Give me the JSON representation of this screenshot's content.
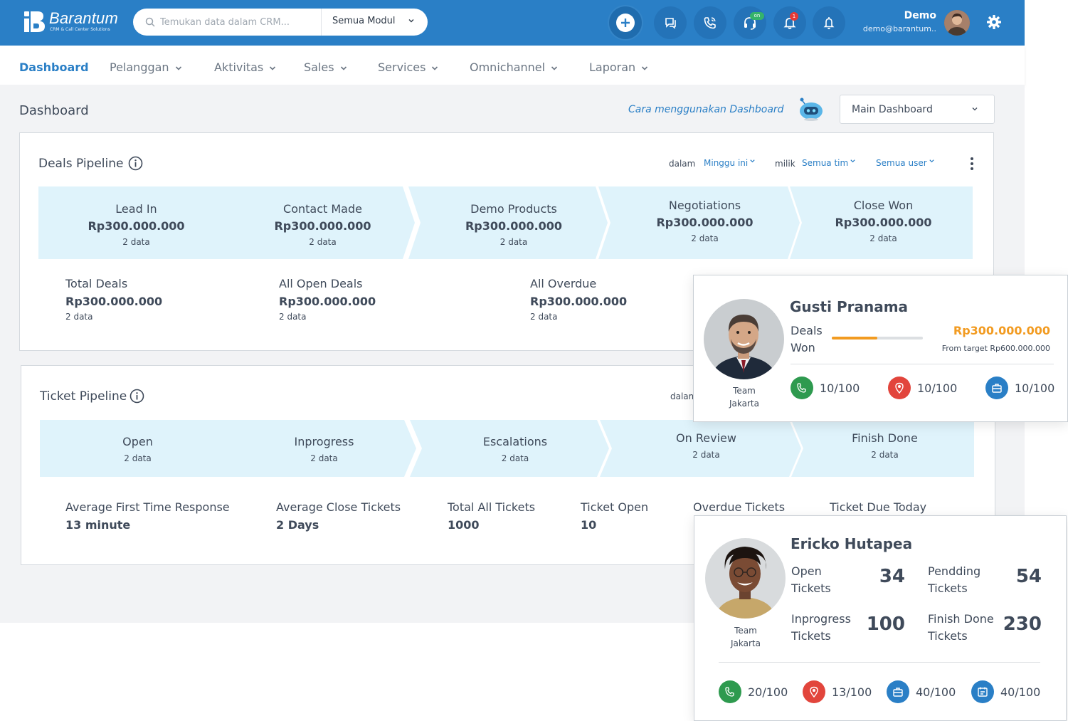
{
  "brand": {
    "name": "Barantum",
    "tagline": "CRM & Call Center Solutions"
  },
  "search": {
    "placeholder": "Temukan data dalam CRM...",
    "module": "Semua Modul"
  },
  "topbar": {
    "status_badge": "on",
    "notification_count": "1",
    "user_name": "Demo",
    "user_email": "demo@barantum.."
  },
  "nav": {
    "items": [
      {
        "label": "Dashboard",
        "active": true
      },
      {
        "label": "Pelanggan"
      },
      {
        "label": "Aktivitas"
      },
      {
        "label": "Sales"
      },
      {
        "label": "Services"
      },
      {
        "label": "Omnichannel"
      },
      {
        "label": "Laporan"
      }
    ]
  },
  "page": {
    "title": "Dashboard",
    "help_link": "Cara menggunakan Dashboard",
    "dashboard_select": "Main Dashboard"
  },
  "deals": {
    "title": "Deals Pipeline",
    "filters": {
      "dalam_label": "dalam",
      "dalam_value": "Minggu ini",
      "milik_label": "milik",
      "team_value": "Semua tim",
      "user_value": "Semua user"
    },
    "stages": [
      {
        "name": "Lead In",
        "amount": "Rp300.000.000",
        "count": "2 data"
      },
      {
        "name": "Contact Made",
        "amount": "Rp300.000.000",
        "count": "2 data"
      },
      {
        "name": "Demo Products",
        "amount": "Rp300.000.000",
        "count": "2 data"
      },
      {
        "name": "Negotiations",
        "amount": "Rp300.000.000",
        "count": "2 data"
      },
      {
        "name": "Close Won",
        "amount": "Rp300.000.000",
        "count": "2 data"
      }
    ],
    "stats": [
      {
        "label": "Total Deals",
        "value": "Rp300.000.000",
        "count": "2 data"
      },
      {
        "label": "All Open Deals",
        "value": "Rp300.000.000",
        "count": "2 data"
      },
      {
        "label": "All Overdue",
        "value": "Rp300.000.000",
        "count": "2 data"
      }
    ]
  },
  "tickets": {
    "title": "Ticket Pipeline",
    "filter_partial": "dalam",
    "stages": [
      {
        "name": "Open",
        "count": "2 data"
      },
      {
        "name": "Inprogress",
        "count": "2 data"
      },
      {
        "name": "Escalations",
        "count": "2 data"
      },
      {
        "name": "On Review",
        "count": "2 data"
      },
      {
        "name": "Finish Done",
        "count": "2 data"
      }
    ],
    "stats": [
      {
        "label": "Average First Time Response",
        "value": "13 minute"
      },
      {
        "label": "Average Close Tickets",
        "value": "2 Days"
      },
      {
        "label": "Total All Tickets",
        "value": "1000"
      },
      {
        "label": "Ticket Open",
        "value": "10"
      },
      {
        "label": "Overdue Tickets",
        "value": ""
      },
      {
        "label": "Ticket Due Today",
        "value": ""
      }
    ]
  },
  "gusti": {
    "name": "Gusti Pranama",
    "team_line1": "Team",
    "team_line2": "Jakarta",
    "deals_label_1": "Deals",
    "deals_label_2": "Won",
    "amount": "Rp300.000.000",
    "target": "From target Rp600.000.000",
    "progress": 0.5,
    "metrics": [
      {
        "icon": "phone-icon",
        "value": "10/100",
        "color": "#2e9a4f"
      },
      {
        "icon": "location-icon",
        "value": "10/100",
        "color": "#e2453c"
      },
      {
        "icon": "briefcase-icon",
        "value": "10/100",
        "color": "#2a7fc6"
      }
    ]
  },
  "ericko": {
    "name": "Ericko Hutapea",
    "team_line1": "Team",
    "team_line2": "Jakarta",
    "tickets": [
      {
        "label1": "Open",
        "label2": "Tickets",
        "value": "34"
      },
      {
        "label1": "Pendding",
        "label2": "Tickets",
        "value": "54"
      },
      {
        "label1": "Inprogress",
        "label2": "Tickets",
        "value": "100"
      },
      {
        "label1": "Finish Done",
        "label2": "Tickets",
        "value": "230"
      }
    ],
    "metrics": [
      {
        "icon": "phone-icon",
        "value": "20/100",
        "color": "#2e9a4f"
      },
      {
        "icon": "location-icon",
        "value": "13/100",
        "color": "#e2453c"
      },
      {
        "icon": "briefcase-icon",
        "value": "40/100",
        "color": "#2a7fc6"
      },
      {
        "icon": "calendar-icon",
        "value": "40/100",
        "color": "#2a7fc6"
      }
    ]
  },
  "colors": {
    "primary": "#2a7fc6",
    "stage_bg": "#dff3fb",
    "accent_orange": "#f29b21",
    "page_bg": "#f2f3f5"
  }
}
